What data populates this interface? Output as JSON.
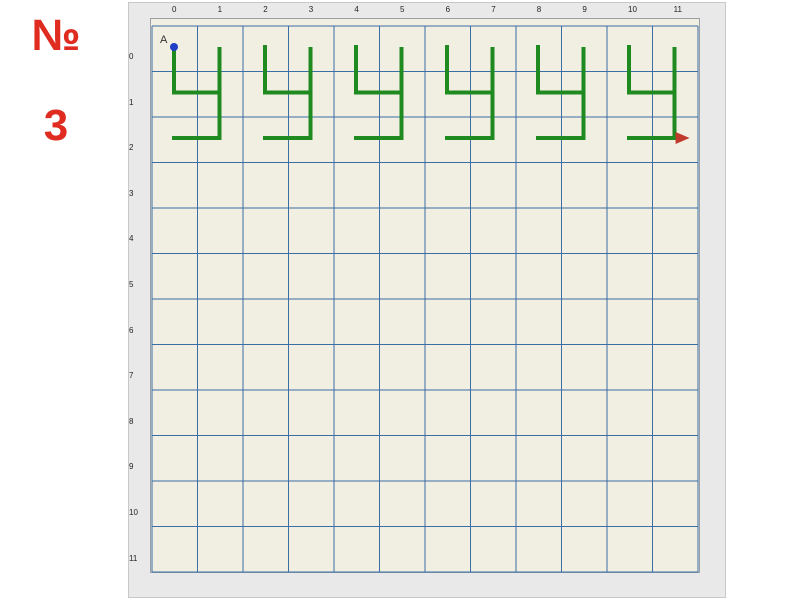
{
  "slide": {
    "title_symbol": "№",
    "title_number": "3"
  },
  "canvas": {
    "x_labels": [
      "0",
      "1",
      "2",
      "3",
      "4",
      "5",
      "6",
      "7",
      "8",
      "9",
      "10",
      "11"
    ],
    "y_labels": [
      "0",
      "1",
      "2",
      "3",
      "4",
      "5",
      "6",
      "7",
      "8",
      "9",
      "10",
      "11"
    ],
    "start_label": "A"
  },
  "colors": {
    "title": "#e02b20",
    "grid": "#3b6ea5",
    "path": "#1f8a1f",
    "start_point": "#1f3fc4",
    "arrow": "#c0392b",
    "canvas_bg": "#f1efe2"
  },
  "figures_count": 6
}
